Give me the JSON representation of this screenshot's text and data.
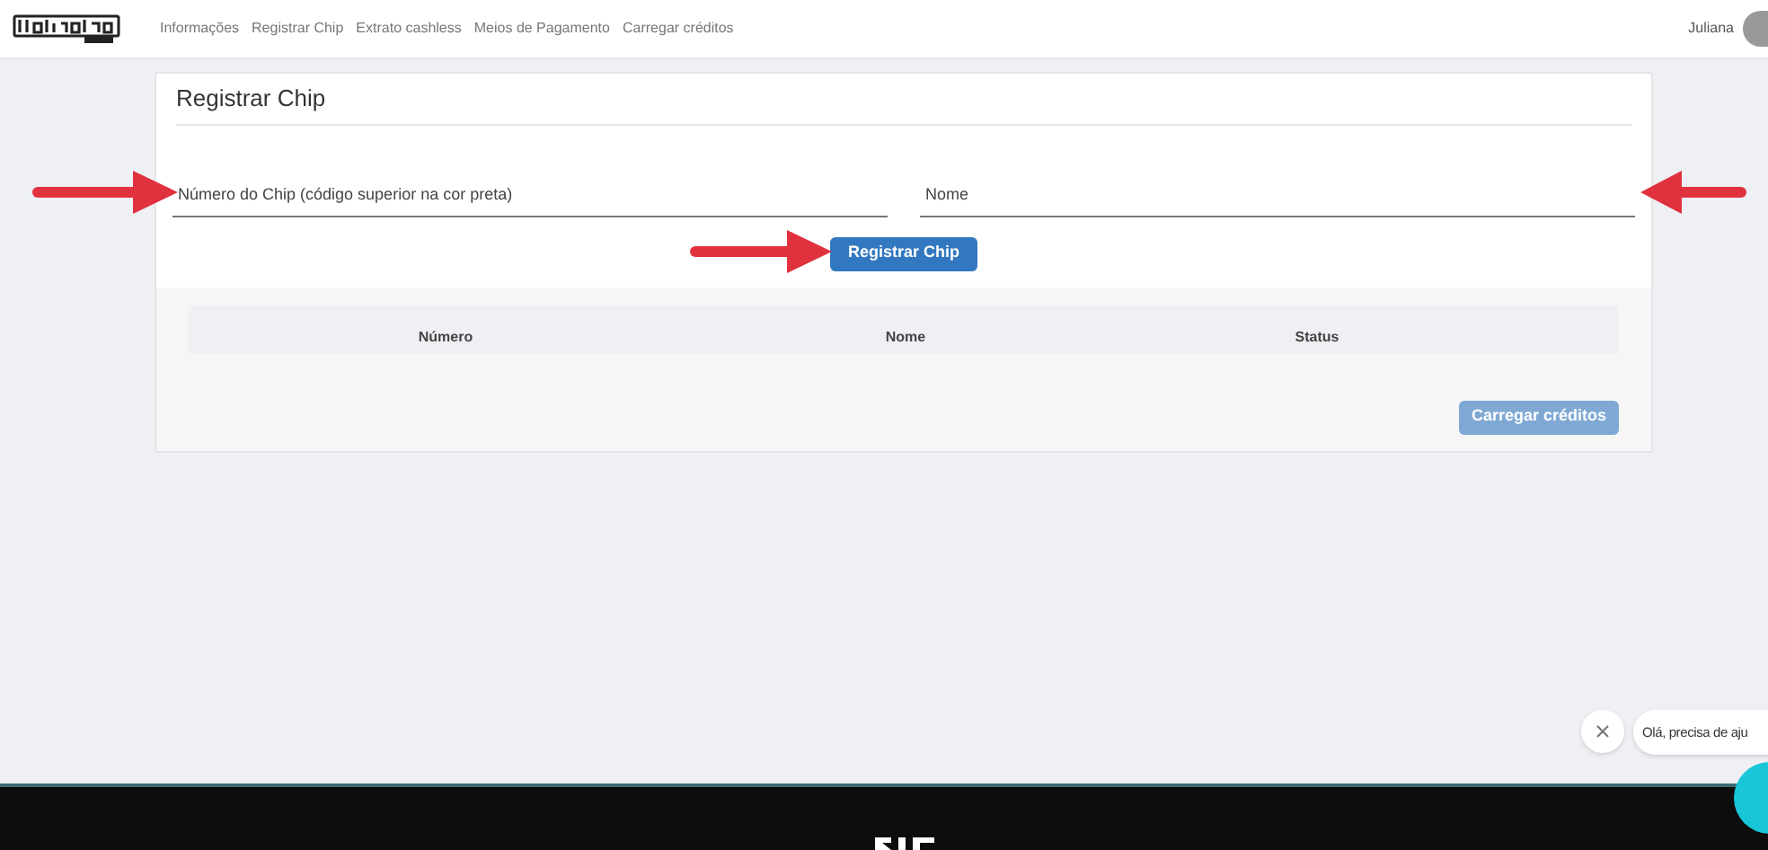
{
  "navbar": {
    "links": [
      {
        "label": "Informações",
        "selected": false
      },
      {
        "label": "Registrar Chip",
        "selected": false
      },
      {
        "label": "Extrato cashless",
        "selected": false
      },
      {
        "label": "Meios de Pagamento",
        "selected": false
      },
      {
        "label": "Carregar créditos",
        "selected": false
      }
    ],
    "user": "Juliana"
  },
  "card": {
    "title": "Registrar Chip",
    "fields": [
      {
        "placeholder": "Número do Chip (código superior na cor preta)"
      },
      {
        "placeholder": "Nome"
      }
    ],
    "submit": {
      "label": "Registrar Chip",
      "disabled": false
    },
    "table": {
      "columns": [
        "Número",
        "Nome",
        "Status"
      ]
    },
    "action": {
      "label": "Carregar créditos",
      "disabled": true
    }
  },
  "chat": {
    "message": "Olá, precisa de aju"
  }
}
